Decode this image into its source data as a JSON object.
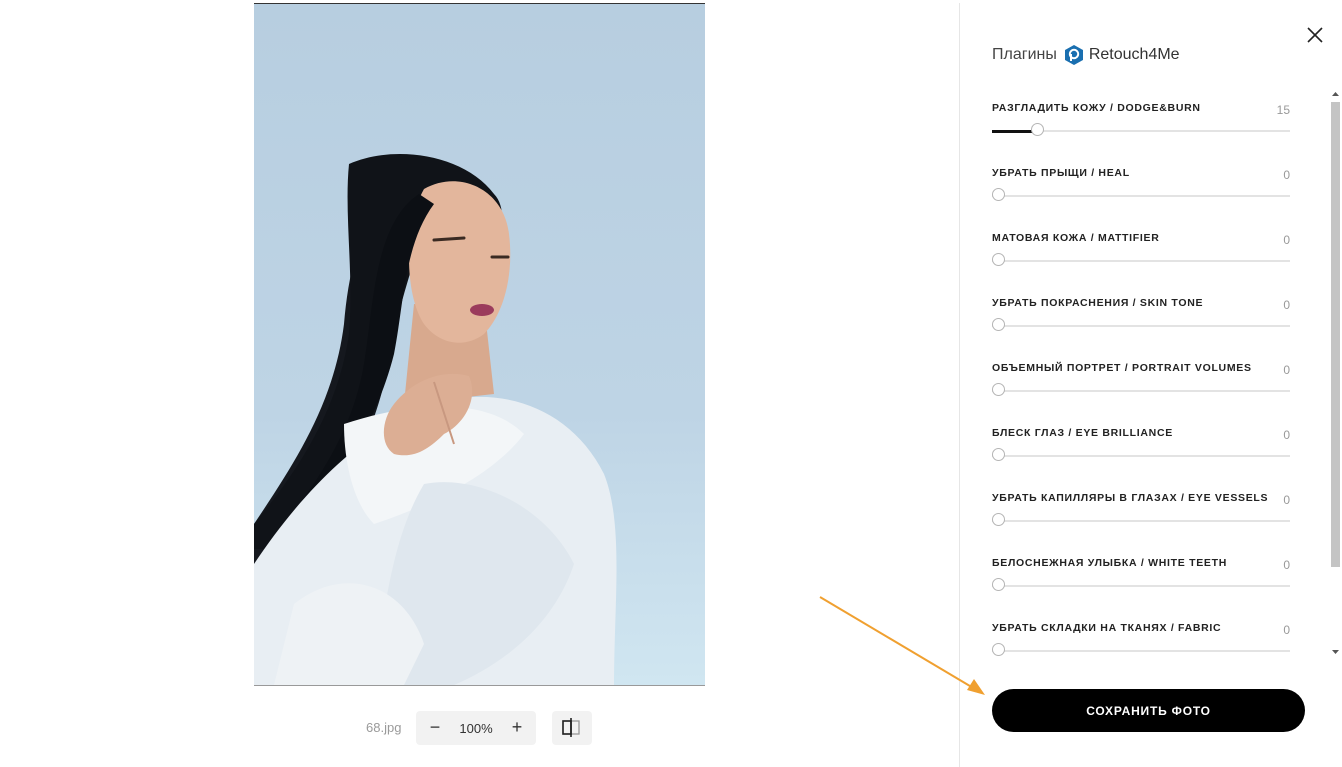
{
  "photo": {
    "filename": "68.jpg"
  },
  "toolbar": {
    "zoom_out": "−",
    "zoom_level": "100%",
    "zoom_in": "+"
  },
  "panel": {
    "title": "Плагины",
    "brand": "Retouch4Me",
    "close_icon": "close-icon",
    "sliders": [
      {
        "label": "РАЗГЛАДИТЬ КОЖУ / DODGE&BURN",
        "value": "15",
        "fraction": 0.15
      },
      {
        "label": "УБРАТЬ ПРЫЩИ / HEAL",
        "value": "0",
        "fraction": 0
      },
      {
        "label": "МАТОВАЯ КОЖА / MATTIFIER",
        "value": "0",
        "fraction": 0
      },
      {
        "label": "УБРАТЬ ПОКРАСНЕНИЯ / SKIN TONE",
        "value": "0",
        "fraction": 0
      },
      {
        "label": "ОБЪЕМНЫЙ ПОРТРЕТ / PORTRAIT VOLUMES",
        "value": "0",
        "fraction": 0
      },
      {
        "label": "БЛЕСК ГЛАЗ / EYE BRILLIANCE",
        "value": "0",
        "fraction": 0
      },
      {
        "label": "УБРАТЬ КАПИЛЛЯРЫ В ГЛАЗАХ / EYE VESSELS",
        "value": "0",
        "fraction": 0
      },
      {
        "label": "БЕЛОСНЕЖНАЯ УЛЫБКА / WHITE TEETH",
        "value": "0",
        "fraction": 0
      },
      {
        "label": "УБРАТЬ СКЛАДКИ НА ТКАНЯХ / FABRIC",
        "value": "0",
        "fraction": 0
      }
    ],
    "save_label": "СОХРАНИТЬ ФОТО"
  },
  "colors": {
    "accent": "#000000",
    "arrow": "#f0a030",
    "brand_icon": "#1a6fb0"
  }
}
